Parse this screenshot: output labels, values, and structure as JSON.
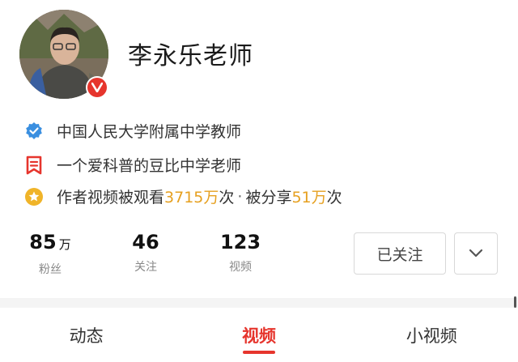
{
  "profile": {
    "name": "李永乐老师",
    "avatar_alt": "avatar"
  },
  "info": {
    "verification": "中国人民大学附属中学教师",
    "bio": "一个爱科普的豆比中学老师",
    "views_prefix": "作者视频被观看",
    "views_count": "3715万",
    "views_suffix": "次",
    "separator": "·",
    "shares_prefix": "被分享",
    "shares_count": "51万",
    "shares_suffix": "次"
  },
  "stats": {
    "fans_value": "85",
    "fans_unit": "万",
    "fans_label": "粉丝",
    "following_value": "46",
    "following_label": "关注",
    "videos_value": "123",
    "videos_label": "视频"
  },
  "actions": {
    "follow_label": "已关注"
  },
  "tabs": [
    {
      "label": "动态",
      "active": false
    },
    {
      "label": "视频",
      "active": true
    },
    {
      "label": "小视频",
      "active": false
    }
  ],
  "colors": {
    "accent": "#e6352d",
    "highlight": "#e6a020",
    "verified_blue": "#3a8fe0"
  },
  "icons": {
    "verified_badge": "verified-v-icon",
    "verification": "blue-check-badge-icon",
    "bio": "bookmark-icon",
    "views": "star-medal-icon",
    "more": "chevron-down-icon"
  }
}
